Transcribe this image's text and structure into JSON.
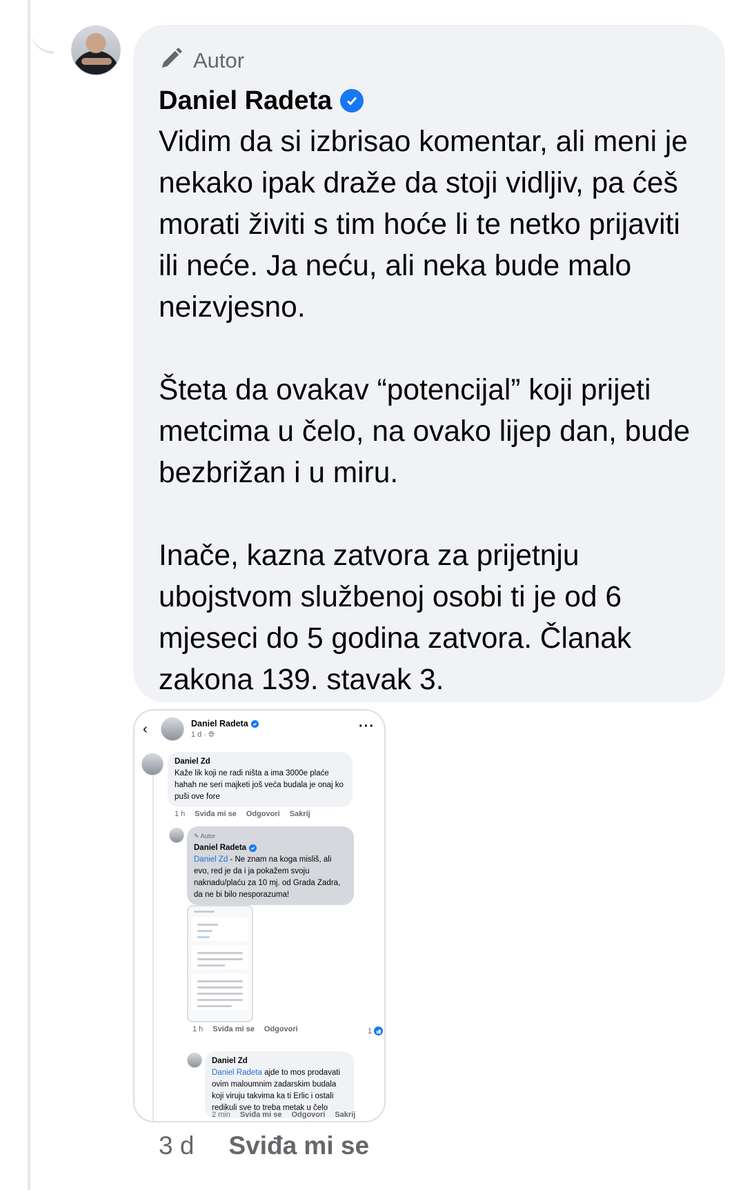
{
  "comment": {
    "author_label": "Autor",
    "author_name": "Daniel Radeta",
    "paragraphs": [
      "Vidim da si izbrisao komentar, ali meni je nekako ipak draže da stoji vidljiv, pa ćeš morati živiti s tim hoće li te netko prijaviti ili neće. Ja neću, ali neka bude malo neizvjesno.",
      "Šteta da ovakav “potencijal” koji prijeti metcima u čelo, na ovako lijep dan, bude bezbrižan i u miru.",
      "Inače, kazna zatvora za prijetnju ubojstvom službenoj osobi ti je od 6 mjeseci do 5 godina zatvora. Članak zakona 139. stavak 3."
    ],
    "time": "3 d",
    "like_label": "Sviđa mi se"
  },
  "screenshot": {
    "header_name": "Daniel Radeta",
    "header_meta": "1 d · ",
    "comment1": {
      "name": "Daniel Zd",
      "text": "Kaže lik koji ne radi ništa a ima 3000e plaće hahah ne seri majketi još veća budala je onaj ko puši ove fore",
      "time": "1 h",
      "like": "Sviđa mi se",
      "reply": "Odgovori",
      "hide": "Sakrij"
    },
    "reply1": {
      "author_label": "Autor",
      "name": "Daniel Radeta",
      "mention": "Daniel Zd",
      "text": " - Ne znam na koga misliš, ali evo, red je da i ja pokažem svoju naknadu/plaću za 10 mj. od Grada Zadra, da ne bi bilo nesporazuma!",
      "time": "1 h",
      "like": "Sviđa mi se",
      "reply": "Odgovori",
      "reaction_count": "1"
    },
    "reply2": {
      "name": "Daniel Zd",
      "mention": "Daniel Radeta",
      "text": " ajde to mos prodavati ovim maloumnim zadarskim budala koji viruju takvima ka ti Erlic i ostali redikuli sve to treba metak u čelo",
      "time": "2 min",
      "like": "Sviđa mi se",
      "reply": "Odgovori",
      "hide": "Sakrij"
    }
  },
  "colors": {
    "bubble": "#f0f2f5",
    "verified": "#1877f2",
    "mention": "#216fdb",
    "meta": "#65676b"
  },
  "icons": [
    "pencil-icon",
    "verified-badge-icon",
    "back-chevron-icon",
    "more-dots-icon",
    "like-thumb-icon",
    "globe-icon"
  ]
}
